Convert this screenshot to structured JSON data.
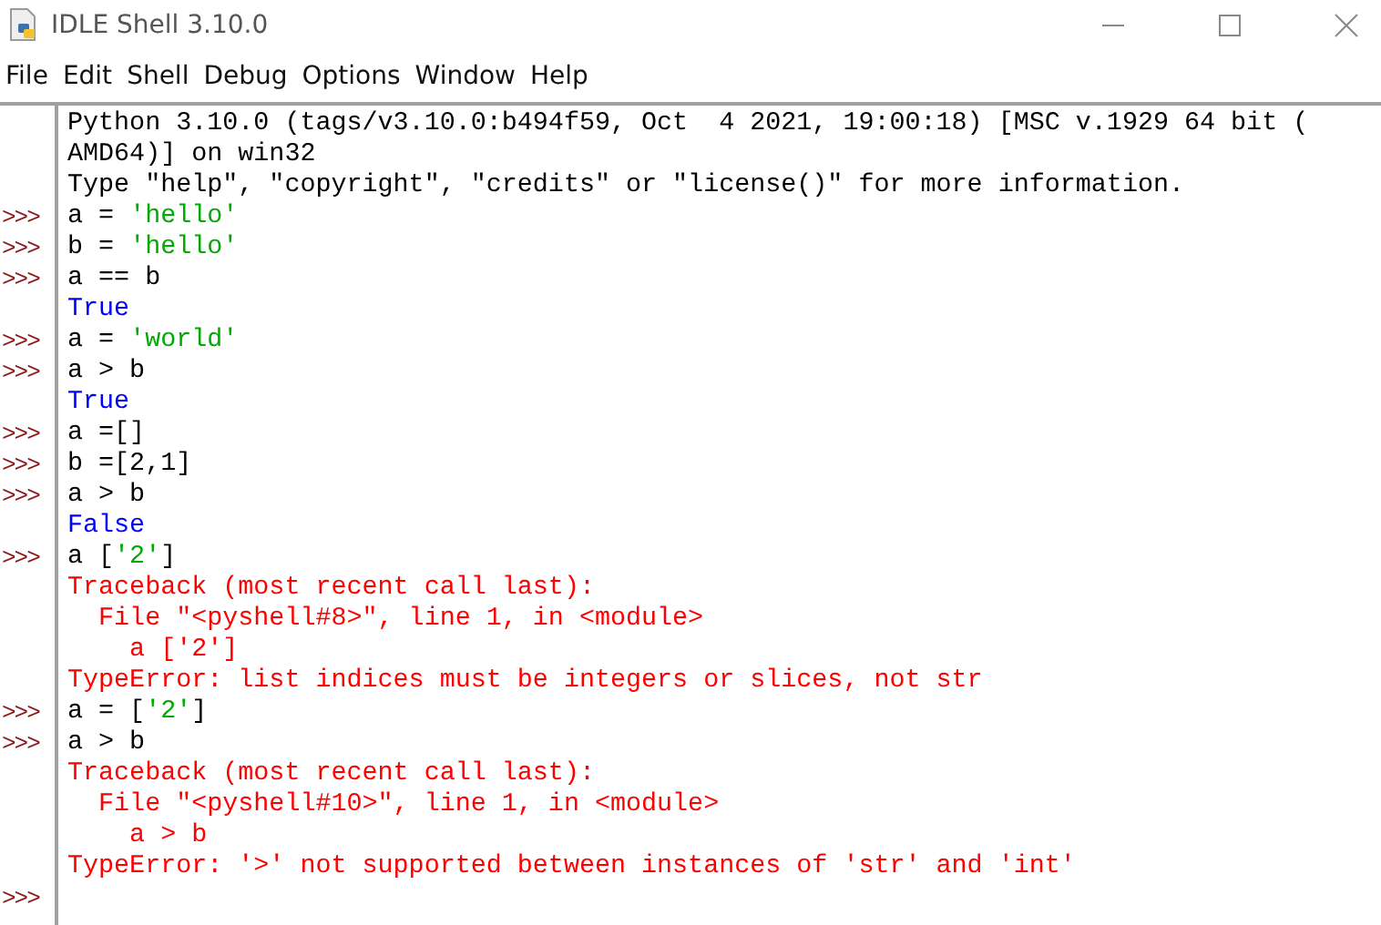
{
  "window": {
    "title": "IDLE Shell 3.10.0"
  },
  "menu": [
    "File",
    "Edit",
    "Shell",
    "Debug",
    "Options",
    "Window",
    "Help"
  ],
  "lines": [
    {
      "segments": [
        {
          "kind": "output",
          "text": "Python 3.10.0 (tags/v3.10.0:b494f59, Oct  4 2021, 19:00:18) [MSC v.1929 64 bit ("
        }
      ]
    },
    {
      "segments": [
        {
          "kind": "output",
          "text": "AMD64)] on win32"
        }
      ]
    },
    {
      "segments": [
        {
          "kind": "output",
          "text": "Type \"help\", \"copyright\", \"credits\" or \"license()\" for more information."
        }
      ]
    },
    {
      "prompt": ">>>",
      "segments": [
        {
          "kind": "code",
          "text": "a = "
        },
        {
          "kind": "string",
          "text": "'hello'"
        }
      ]
    },
    {
      "prompt": ">>>",
      "segments": [
        {
          "kind": "code",
          "text": "b = "
        },
        {
          "kind": "string",
          "text": "'hello'"
        }
      ]
    },
    {
      "prompt": ">>>",
      "segments": [
        {
          "kind": "code",
          "text": "a == b"
        }
      ]
    },
    {
      "segments": [
        {
          "kind": "result",
          "text": "True"
        }
      ]
    },
    {
      "prompt": ">>>",
      "segments": [
        {
          "kind": "code",
          "text": "a = "
        },
        {
          "kind": "string",
          "text": "'world'"
        }
      ]
    },
    {
      "prompt": ">>>",
      "segments": [
        {
          "kind": "code",
          "text": "a > b"
        }
      ]
    },
    {
      "segments": [
        {
          "kind": "result",
          "text": "True"
        }
      ]
    },
    {
      "prompt": ">>>",
      "segments": [
        {
          "kind": "code",
          "text": "a =[]"
        }
      ]
    },
    {
      "prompt": ">>>",
      "segments": [
        {
          "kind": "code",
          "text": "b =[2,1]"
        }
      ]
    },
    {
      "prompt": ">>>",
      "segments": [
        {
          "kind": "code",
          "text": "a > b"
        }
      ]
    },
    {
      "segments": [
        {
          "kind": "result",
          "text": "False"
        }
      ]
    },
    {
      "prompt": ">>>",
      "segments": [
        {
          "kind": "code",
          "text": "a ["
        },
        {
          "kind": "string",
          "text": "'2'"
        },
        {
          "kind": "code",
          "text": "]"
        }
      ]
    },
    {
      "segments": [
        {
          "kind": "error",
          "text": "Traceback (most recent call last):"
        }
      ]
    },
    {
      "segments": [
        {
          "kind": "error",
          "text": "  File \"<pyshell#8>\", line 1, in <module>"
        }
      ]
    },
    {
      "segments": [
        {
          "kind": "error",
          "text": "    a ['2']"
        }
      ]
    },
    {
      "segments": [
        {
          "kind": "error",
          "text": "TypeError: list indices must be integers or slices, not str"
        }
      ]
    },
    {
      "prompt": ">>>",
      "segments": [
        {
          "kind": "code",
          "text": "a = ["
        },
        {
          "kind": "string",
          "text": "'2'"
        },
        {
          "kind": "code",
          "text": "]"
        }
      ]
    },
    {
      "prompt": ">>>",
      "segments": [
        {
          "kind": "code",
          "text": "a > b"
        }
      ]
    },
    {
      "segments": [
        {
          "kind": "error",
          "text": "Traceback (most recent call last):"
        }
      ]
    },
    {
      "segments": [
        {
          "kind": "error",
          "text": "  File \"<pyshell#10>\", line 1, in <module>"
        }
      ]
    },
    {
      "segments": [
        {
          "kind": "error",
          "text": "    a > b"
        }
      ]
    },
    {
      "segments": [
        {
          "kind": "error",
          "text": "TypeError: '>' not supported between instances of 'str' and 'int'"
        }
      ]
    },
    {
      "prompt": ">>>"
    }
  ]
}
